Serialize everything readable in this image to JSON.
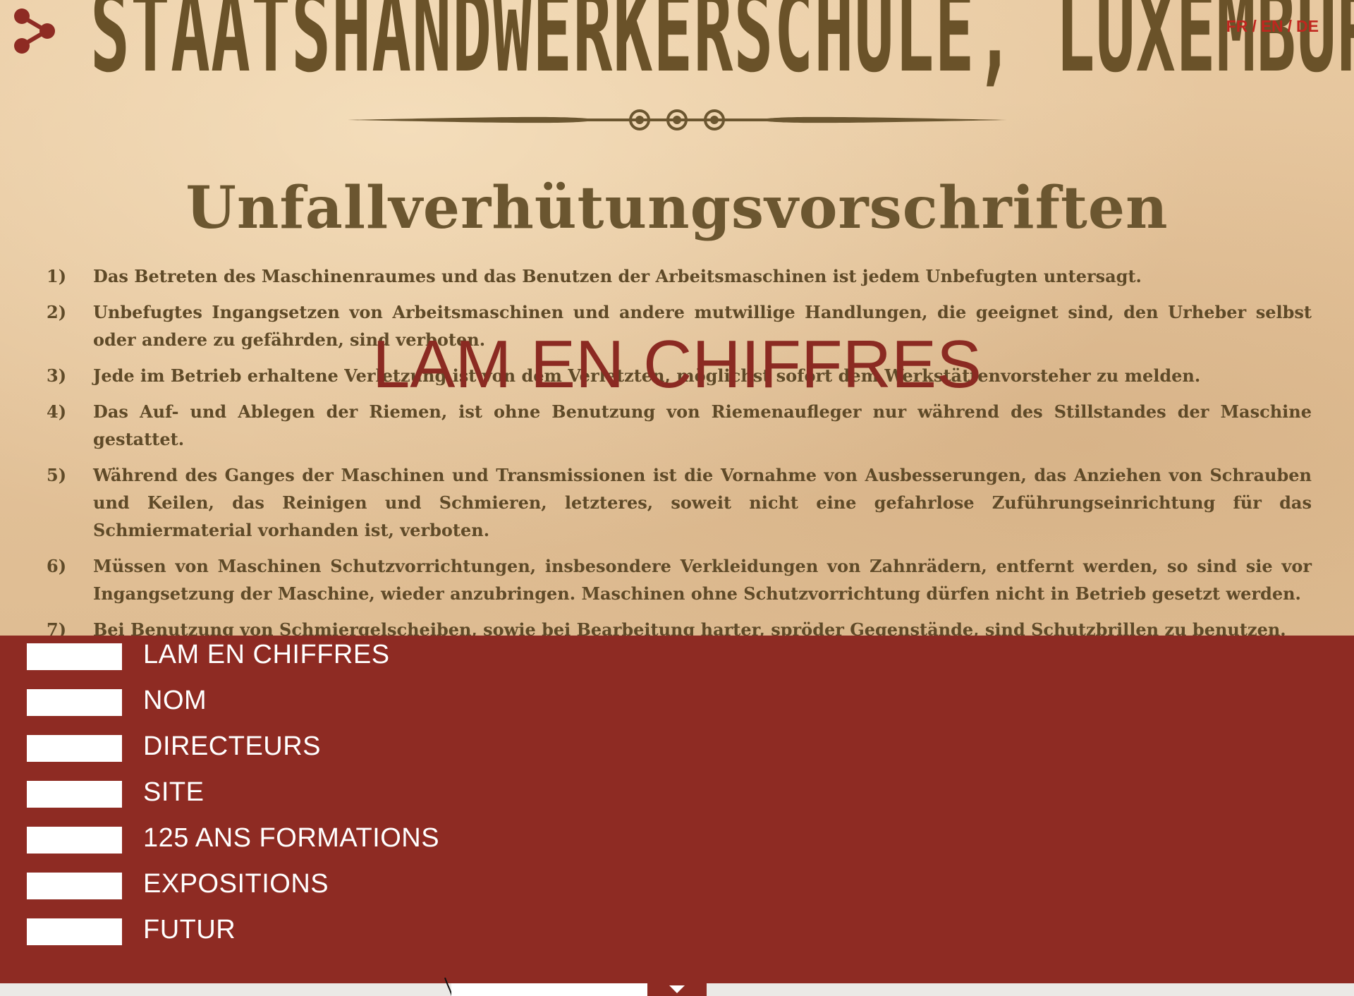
{
  "hero": {
    "poster_header": "STAATSHANDWERKERSCHULE, LUXEMBURG",
    "poster_title": "Unfallverhütungsvorschriften",
    "rules": [
      {
        "num": "1)",
        "text": "Das Betreten des Maschinenraumes und das Benutzen der Arbeitsmaschinen ist jedem Unbefugten untersagt."
      },
      {
        "num": "2)",
        "text": "Unbefugtes Ingangsetzen von Arbeitsmaschinen und andere mutwillige Handlungen, die geeignet sind, den Urheber selbst oder andere zu gefährden, sind verboten."
      },
      {
        "num": "3)",
        "text": "Jede im Betrieb erhaltene Verletzung ist von dem Verletzten, möglichst sofort dem Werkstättenvorsteher zu melden."
      },
      {
        "num": "4)",
        "text": "Das Auf- und Ablegen der Riemen, ist ohne Benutzung von Riemenaufleger nur während des Stillstandes der Maschine gestattet."
      },
      {
        "num": "5)",
        "text": "Während des Ganges der Maschinen und Transmissionen ist die Vornahme von Ausbesserungen, das Anziehen von Schrauben und Keilen, das Reinigen und Schmieren, letzteres, soweit nicht eine gefahrlose Zuführungseinrichtung für das Schmiermaterial vorhanden ist, verboten."
      },
      {
        "num": "6)",
        "text": "Müssen von Maschinen Schutzvorrichtungen, insbesondere Verkleidungen von Zahnrädern, entfernt werden, so sind sie vor Ingangsetzung der Maschine, wieder anzubringen. Maschinen ohne Schutzvorrichtung dürfen nicht in Betrieb gesetzt werden."
      },
      {
        "num": "7)",
        "text": "Bei Benutzung von Schmiergelscheiben, sowie bei Bearbeitung harter, spröder Gegenstände, sind Schutzbrillen zu benutzen."
      }
    ],
    "section_heading": "LAM EN CHIFFRES"
  },
  "header": {
    "share_icon": "share-icon",
    "languages": [
      "FR",
      "EN",
      "DE"
    ],
    "separator": "/"
  },
  "menu": {
    "items": [
      {
        "label": "LAM EN CHIFFRES"
      },
      {
        "label": "NOM"
      },
      {
        "label": "DIRECTEURS"
      },
      {
        "label": "SITE"
      },
      {
        "label": "125 ANS FORMATIONS"
      },
      {
        "label": "EXPOSITIONS"
      },
      {
        "label": "FUTUR"
      }
    ]
  },
  "footer": {
    "scroll_icon": "caret-down-icon"
  },
  "colors": {
    "brand_red": "#8e2b23",
    "heading_red": "#8b2a22",
    "lang_red": "#c0271f",
    "paper": "#e6c59c",
    "ink": "#5f4a28"
  }
}
